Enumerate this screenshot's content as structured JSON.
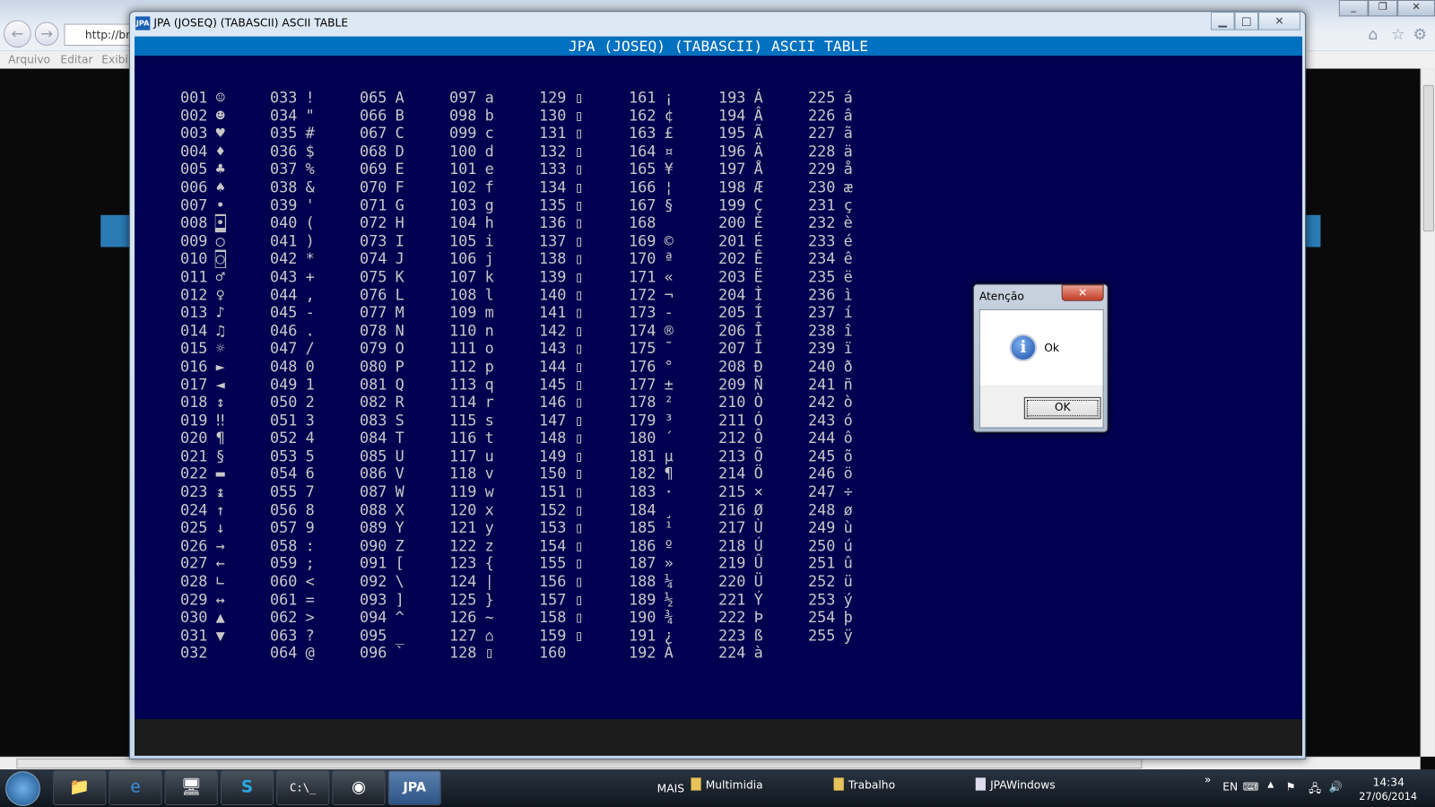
{
  "browser": {
    "address": "http://br",
    "menu": [
      "Arquivo",
      "Editar",
      "Exibir"
    ]
  },
  "window": {
    "title": "JPA (JOSEQ) (TABASCII) ASCII TABLE",
    "logo": "JPA",
    "header": "JPA (JOSEQ) (TABASCII) ASCII TABLE"
  },
  "table": {
    "columns": [
      {
        "start": 1,
        "chars": [
          "☺",
          "☻",
          "♥",
          "♦",
          "♣",
          "♠",
          "•",
          "◘",
          "○",
          "◙",
          "♂",
          "♀",
          "♪",
          "♫",
          "☼",
          "►",
          "◄",
          "↕",
          "‼",
          "¶",
          "§",
          "▬",
          "↨",
          "↑",
          "↓",
          "→",
          "←",
          "∟",
          "↔",
          "▲",
          "▼",
          " "
        ]
      },
      {
        "start": 33,
        "chars": [
          "!",
          "\"",
          "#",
          "$",
          "%",
          "&",
          "'",
          "(",
          ")",
          "*",
          "+",
          ",",
          "-",
          ".",
          "/",
          "0",
          "1",
          "2",
          "3",
          "4",
          "5",
          "6",
          "7",
          "8",
          "9",
          ":",
          ";",
          "<",
          "=",
          ">",
          "?",
          "@"
        ]
      },
      {
        "start": 65,
        "chars": [
          "A",
          "B",
          "C",
          "D",
          "E",
          "F",
          "G",
          "H",
          "I",
          "J",
          "K",
          "L",
          "M",
          "N",
          "O",
          "P",
          "Q",
          "R",
          "S",
          "T",
          "U",
          "V",
          "W",
          "X",
          "Y",
          "Z",
          "[",
          "\\",
          "]",
          "^",
          "_",
          "`"
        ]
      },
      {
        "start": 97,
        "chars": [
          "a",
          "b",
          "c",
          "d",
          "e",
          "f",
          "g",
          "h",
          "i",
          "j",
          "k",
          "l",
          "m",
          "n",
          "o",
          "p",
          "q",
          "r",
          "s",
          "t",
          "u",
          "v",
          "w",
          "x",
          "y",
          "z",
          "{",
          "|",
          "}",
          "~",
          "⌂",
          "▯"
        ]
      },
      {
        "start": 129,
        "chars": [
          "▯",
          "▯",
          "▯",
          "▯",
          "▯",
          "▯",
          "▯",
          "▯",
          "▯",
          "▯",
          "▯",
          "▯",
          "▯",
          "▯",
          "▯",
          "▯",
          "▯",
          "▯",
          "▯",
          "▯",
          "▯",
          "▯",
          "▯",
          "▯",
          "▯",
          "▯",
          "▯",
          "▯",
          "▯",
          "▯",
          "▯",
          " "
        ]
      },
      {
        "start": 161,
        "chars": [
          "¡",
          "¢",
          "£",
          "¤",
          "¥",
          "¦",
          "§",
          " ",
          "©",
          "ª",
          "«",
          "¬",
          "-",
          "®",
          "¯",
          "°",
          "±",
          "²",
          "³",
          "´",
          "µ",
          "¶",
          "·",
          "¸",
          "¹",
          "º",
          "»",
          "¼",
          "½",
          "¾",
          "¿",
          "À"
        ]
      },
      {
        "start": 193,
        "chars": [
          "Á",
          "Â",
          "Ã",
          "Ä",
          "Å",
          "Æ",
          "Ç",
          "È",
          "É",
          "Ê",
          "Ë",
          "Ì",
          "Í",
          "Î",
          "Ï",
          "Ð",
          "Ñ",
          "Ò",
          "Ó",
          "Ô",
          "Õ",
          "Ö",
          "×",
          "Ø",
          "Ù",
          "Ú",
          "Û",
          "Ü",
          "Ý",
          "Þ",
          "ß",
          "à"
        ]
      },
      {
        "start": 225,
        "chars": [
          "á",
          "â",
          "ã",
          "ä",
          "å",
          "æ",
          "ç",
          "è",
          "é",
          "ê",
          "ë",
          "ì",
          "í",
          "î",
          "ï",
          "ð",
          "ñ",
          "ò",
          "ó",
          "ô",
          "õ",
          "ö",
          "÷",
          "ø",
          "ù",
          "ú",
          "û",
          "ü",
          "ý",
          "þ",
          "ÿ"
        ]
      }
    ]
  },
  "dialog": {
    "title": "Atenção",
    "message": "Ok",
    "ok_label": "OK"
  },
  "taskbar": {
    "more": "MAIS",
    "toolbars": [
      "Multimidia",
      "Trabalho",
      "JPAWindows"
    ],
    "lang": "EN",
    "time": "14:34",
    "date": "27/06/2014"
  }
}
